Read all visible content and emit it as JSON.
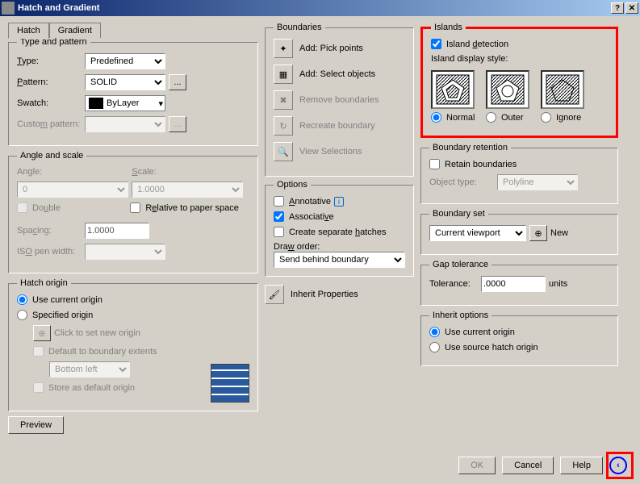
{
  "title": "Hatch and Gradient",
  "tabs": {
    "hatch": "Hatch",
    "gradient": "Gradient"
  },
  "typePattern": {
    "legend": "Type and pattern",
    "typeLabel": "Type:",
    "typeValue": "Predefined",
    "patternLabel": "Pattern:",
    "patternValue": "SOLID",
    "swatchLabel": "Swatch:",
    "swatchValue": "ByLayer",
    "customLabel": "Custom pattern:"
  },
  "angleScale": {
    "legend": "Angle and scale",
    "angleLabel": "Angle:",
    "angleValue": "0",
    "scaleLabel": "Scale:",
    "scaleValue": "1.0000",
    "doubleLabel": "Double",
    "relativeLabel": "Relative to paper space",
    "spacingLabel": "Spacing:",
    "spacingValue": "1.0000",
    "isoLabel": "ISO pen width:"
  },
  "hatchOrigin": {
    "legend": "Hatch origin",
    "useCurrent": "Use current origin",
    "specified": "Specified origin",
    "clickSet": "Click to set new origin",
    "defaultBoundary": "Default to boundary extents",
    "bottomLeft": "Bottom left",
    "storeDefault": "Store as default origin"
  },
  "preview": "Preview",
  "boundaries": {
    "legend": "Boundaries",
    "addPick": "Add: Pick points",
    "addSelect": "Add: Select objects",
    "remove": "Remove boundaries",
    "recreate": "Recreate boundary",
    "viewSel": "View Selections"
  },
  "options": {
    "legend": "Options",
    "annotative": "Annotative",
    "associative": "Associative",
    "separate": "Create separate hatches",
    "drawOrderLabel": "Draw order:",
    "drawOrderValue": "Send behind boundary"
  },
  "inheritProps": "Inherit Properties",
  "islands": {
    "legend": "Islands",
    "detection": "Island detection",
    "styleLabel": "Island display style:",
    "normal": "Normal",
    "outer": "Outer",
    "ignore": "Ignore"
  },
  "boundaryRetention": {
    "legend": "Boundary retention",
    "retain": "Retain boundaries",
    "objectTypeLabel": "Object type:",
    "objectTypeValue": "Polyline"
  },
  "boundarySet": {
    "legend": "Boundary set",
    "value": "Current viewport",
    "new": "New"
  },
  "gapTolerance": {
    "legend": "Gap tolerance",
    "label": "Tolerance:",
    "value": ".0000",
    "units": "units"
  },
  "inheritOptions": {
    "legend": "Inherit options",
    "useCurrent": "Use current origin",
    "useSource": "Use source hatch origin"
  },
  "buttons": {
    "ok": "OK",
    "cancel": "Cancel",
    "help": "Help"
  }
}
